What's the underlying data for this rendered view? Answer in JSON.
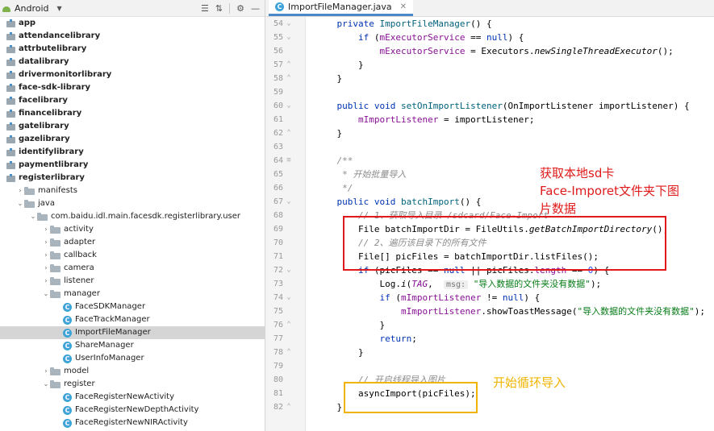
{
  "left_panel": {
    "view_selector": "Android",
    "tree": [
      {
        "label": "app",
        "kind": "module",
        "bold": true
      },
      {
        "label": "attendancelibrary",
        "kind": "module",
        "bold": true
      },
      {
        "label": "attrbutelibrary",
        "kind": "module",
        "bold": true
      },
      {
        "label": "datalibrary",
        "kind": "module",
        "bold": true
      },
      {
        "label": "drivermonitorlibrary",
        "kind": "module",
        "bold": true
      },
      {
        "label": "face-sdk-library",
        "kind": "module",
        "bold": true
      },
      {
        "label": "facelibrary",
        "kind": "module",
        "bold": true
      },
      {
        "label": "financelibrary",
        "kind": "module",
        "bold": true
      },
      {
        "label": "gatelibrary",
        "kind": "module",
        "bold": true
      },
      {
        "label": "gazelibrary",
        "kind": "module",
        "bold": true
      },
      {
        "label": "identifylibrary",
        "kind": "module",
        "bold": true
      },
      {
        "label": "paymentlibrary",
        "kind": "module",
        "bold": true
      },
      {
        "label": "registerlibrary",
        "kind": "module",
        "bold": true,
        "expanded": true
      },
      {
        "label": "manifests",
        "kind": "folder",
        "depth": 1,
        "collapsed": true
      },
      {
        "label": "java",
        "kind": "folder",
        "depth": 1,
        "expanded": true
      },
      {
        "label": "com.baidu.idl.main.facesdk.registerlibrary.user",
        "kind": "folder",
        "depth": 2,
        "expanded": true
      },
      {
        "label": "activity",
        "kind": "folder",
        "depth": 3,
        "collapsed": true
      },
      {
        "label": "adapter",
        "kind": "folder",
        "depth": 3,
        "collapsed": true
      },
      {
        "label": "callback",
        "kind": "folder",
        "depth": 3,
        "collapsed": true
      },
      {
        "label": "camera",
        "kind": "folder",
        "depth": 3,
        "collapsed": true
      },
      {
        "label": "listener",
        "kind": "folder",
        "depth": 3,
        "collapsed": true
      },
      {
        "label": "manager",
        "kind": "folder",
        "depth": 3,
        "expanded": true
      },
      {
        "label": "FaceSDKManager",
        "kind": "class",
        "depth": 4
      },
      {
        "label": "FaceTrackManager",
        "kind": "class",
        "depth": 4
      },
      {
        "label": "ImportFileManager",
        "kind": "class",
        "depth": 4,
        "selected": true
      },
      {
        "label": "ShareManager",
        "kind": "class",
        "depth": 4
      },
      {
        "label": "UserInfoManager",
        "kind": "class",
        "depth": 4
      },
      {
        "label": "model",
        "kind": "folder",
        "depth": 3,
        "collapsed": true
      },
      {
        "label": "register",
        "kind": "folder",
        "depth": 3,
        "expanded": true
      },
      {
        "label": "FaceRegisterNewActivity",
        "kind": "class",
        "depth": 4
      },
      {
        "label": "FaceRegisterNewDepthActivity",
        "kind": "class",
        "depth": 4
      },
      {
        "label": "FaceRegisterNewNIRActivity",
        "kind": "class",
        "depth": 4
      }
    ]
  },
  "editor": {
    "tab_label": "ImportFileManager.java",
    "class_icon_letter": "C",
    "lines": [
      {
        "n": "54",
        "code": [
          [
            "    ",
            ""
          ],
          [
            "private ",
            "kw"
          ],
          [
            "ImportFileManager",
            "fn"
          ],
          [
            "() {",
            ""
          ]
        ]
      },
      {
        "n": "55",
        "code": [
          [
            "        ",
            ""
          ],
          [
            "if ",
            "kw"
          ],
          [
            "(",
            ""
          ],
          [
            "mExecutorService",
            "fld"
          ],
          [
            " == ",
            ""
          ],
          [
            "null",
            "kw"
          ],
          [
            ") {",
            ""
          ]
        ]
      },
      {
        "n": "56",
        "code": [
          [
            "            ",
            ""
          ],
          [
            "mExecutorService",
            "fld"
          ],
          [
            " = Executors.",
            ""
          ],
          [
            "newSingleThreadExecutor",
            "ital"
          ],
          [
            "();",
            ""
          ]
        ]
      },
      {
        "n": "57",
        "code": [
          [
            "        }",
            ""
          ]
        ]
      },
      {
        "n": "58",
        "code": [
          [
            "    }",
            ""
          ]
        ]
      },
      {
        "n": "59",
        "code": []
      },
      {
        "n": "60",
        "code": [
          [
            "    ",
            ""
          ],
          [
            "public void ",
            "kw"
          ],
          [
            "setOnImportListener",
            "fn"
          ],
          [
            "(OnImportListener importListener) {",
            ""
          ]
        ]
      },
      {
        "n": "61",
        "code": [
          [
            "        ",
            ""
          ],
          [
            "mImportListener",
            "fld"
          ],
          [
            " = importListener;",
            ""
          ]
        ]
      },
      {
        "n": "62",
        "code": [
          [
            "    }",
            ""
          ]
        ]
      },
      {
        "n": "63",
        "code": []
      },
      {
        "n": "64",
        "code": [
          [
            "    ",
            ""
          ],
          [
            "/**",
            "cmt"
          ]
        ]
      },
      {
        "n": "65",
        "code": [
          [
            "     ",
            ""
          ],
          [
            "* 开始批量导入",
            "cmt"
          ]
        ]
      },
      {
        "n": "66",
        "code": [
          [
            "     ",
            ""
          ],
          [
            "*/",
            "cmt"
          ]
        ]
      },
      {
        "n": "67",
        "code": [
          [
            "    ",
            ""
          ],
          [
            "public void ",
            "kw"
          ],
          [
            "batchImport",
            "fn"
          ],
          [
            "() {",
            ""
          ]
        ]
      },
      {
        "n": "68",
        "code": [
          [
            "        ",
            ""
          ],
          [
            "// 1、获取导入目录 /sdcard/Face-Import",
            "cmt"
          ]
        ]
      },
      {
        "n": "69",
        "code": [
          [
            "        File batchImportDir = FileUtils.",
            ""
          ],
          [
            "getBatchImportDirectory",
            "ital"
          ],
          [
            "();",
            ""
          ]
        ]
      },
      {
        "n": "70",
        "code": [
          [
            "        ",
            ""
          ],
          [
            "// 2、遍历该目录下的所有文件",
            "cmt"
          ]
        ]
      },
      {
        "n": "71",
        "code": [
          [
            "        File[] picFiles = batchImportDir.listFiles();",
            ""
          ]
        ]
      },
      {
        "n": "72",
        "code": [
          [
            "        ",
            ""
          ],
          [
            "if ",
            "kw"
          ],
          [
            "(picFiles == ",
            ""
          ],
          [
            "null",
            "kw"
          ],
          [
            " || picFiles.",
            ""
          ],
          [
            "length",
            "fld"
          ],
          [
            " == ",
            ""
          ],
          [
            "0",
            "num"
          ],
          [
            ") {",
            ""
          ]
        ]
      },
      {
        "n": "73",
        "code": [
          [
            "            Log.",
            ""
          ],
          [
            "i",
            "ital"
          ],
          [
            "(",
            ""
          ],
          [
            "TAG",
            "fld ital"
          ],
          [
            ",  ",
            ""
          ],
          [
            "msg:",
            "hint"
          ],
          [
            " ",
            ""
          ],
          [
            "\"导入数据的文件夹没有数据\"",
            "str"
          ],
          [
            ");",
            ""
          ]
        ]
      },
      {
        "n": "74",
        "code": [
          [
            "            ",
            ""
          ],
          [
            "if ",
            "kw"
          ],
          [
            "(",
            ""
          ],
          [
            "mImportListener",
            "fld"
          ],
          [
            " != ",
            ""
          ],
          [
            "null",
            "kw"
          ],
          [
            ") {",
            ""
          ]
        ]
      },
      {
        "n": "75",
        "code": [
          [
            "                ",
            ""
          ],
          [
            "mImportListener",
            "fld"
          ],
          [
            ".showToastMessage(",
            ""
          ],
          [
            "\"导入数据的文件夹没有数据\"",
            "str"
          ],
          [
            ");",
            ""
          ]
        ]
      },
      {
        "n": "76",
        "code": [
          [
            "            }",
            ""
          ]
        ]
      },
      {
        "n": "77",
        "code": [
          [
            "            ",
            ""
          ],
          [
            "return",
            "kw"
          ],
          [
            ";",
            ""
          ]
        ]
      },
      {
        "n": "78",
        "code": [
          [
            "        }",
            ""
          ]
        ]
      },
      {
        "n": "79",
        "code": []
      },
      {
        "n": "80",
        "code": [
          [
            "        ",
            ""
          ],
          [
            "// 开启线程导入图片",
            "cmt"
          ]
        ]
      },
      {
        "n": "81",
        "code": [
          [
            "        asyncImport(picFiles);",
            ""
          ]
        ]
      },
      {
        "n": "82",
        "code": [
          [
            "    }",
            ""
          ]
        ]
      }
    ]
  },
  "annotations": {
    "red_note": [
      "获取本地sd卡",
      "Face-Imporet文件夹下图",
      "片数据"
    ],
    "orange_note": "开始循环导入",
    "red_color": "#e01a1a",
    "orange_color": "#f0b400"
  }
}
